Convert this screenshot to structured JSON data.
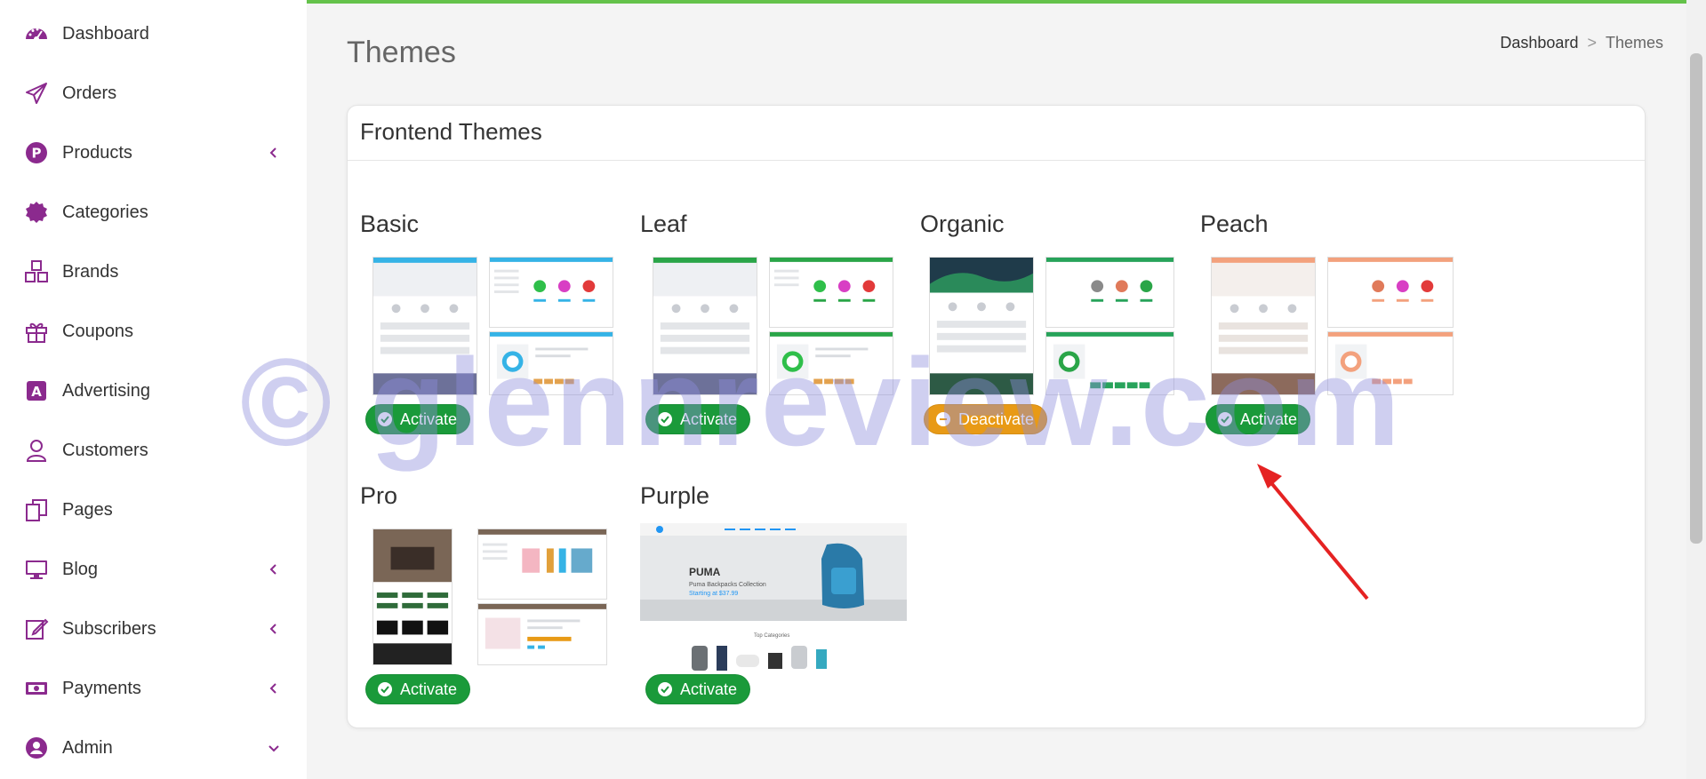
{
  "colors": {
    "accent": "#8b2a8e",
    "topbar": "#64c24a",
    "activate": "#1a9a3a",
    "deactivate": "#e89a16",
    "arrow": "#e52222"
  },
  "sidebar": {
    "items": [
      {
        "label": "Dashboard",
        "icon": "dashboard-gauge-icon",
        "chevron": ""
      },
      {
        "label": "Orders",
        "icon": "paper-plane-icon",
        "chevron": ""
      },
      {
        "label": "Products",
        "icon": "p-circle-icon",
        "chevron": "chevron-left-icon"
      },
      {
        "label": "Categories",
        "icon": "badge-icon",
        "chevron": ""
      },
      {
        "label": "Brands",
        "icon": "cubes-icon",
        "chevron": ""
      },
      {
        "label": "Coupons",
        "icon": "gift-icon",
        "chevron": ""
      },
      {
        "label": "Advertising",
        "icon": "ad-square-icon",
        "chevron": ""
      },
      {
        "label": "Customers",
        "icon": "user-icon",
        "chevron": ""
      },
      {
        "label": "Pages",
        "icon": "pages-icon",
        "chevron": ""
      },
      {
        "label": "Blog",
        "icon": "monitor-icon",
        "chevron": "chevron-left-icon"
      },
      {
        "label": "Subscribers",
        "icon": "edit-icon",
        "chevron": "chevron-left-icon"
      },
      {
        "label": "Payments",
        "icon": "money-bill-icon",
        "chevron": "chevron-left-icon"
      },
      {
        "label": "Admin",
        "icon": "user-circle-icon",
        "chevron": "chevron-down-icon"
      }
    ]
  },
  "header": {
    "title": "Themes",
    "breadcrumb": {
      "home": "Dashboard",
      "separator": ">",
      "current": "Themes"
    }
  },
  "card": {
    "title": "Frontend Themes"
  },
  "themes": [
    {
      "name": "Basic",
      "button": "Activate",
      "state": "inactive",
      "palette": "#35b3e6"
    },
    {
      "name": "Leaf",
      "button": "Activate",
      "state": "inactive",
      "palette": "#2aa548"
    },
    {
      "name": "Organic",
      "button": "Deactivate",
      "state": "active",
      "palette": "#27a35a"
    },
    {
      "name": "Peach",
      "button": "Activate",
      "state": "inactive",
      "palette": "#f3a17d"
    },
    {
      "name": "Pro",
      "button": "Activate",
      "state": "inactive",
      "palette": "#7a6656"
    },
    {
      "name": "Purple",
      "button": "Activate",
      "state": "inactive",
      "palette": "#2196f3"
    }
  ],
  "purple_preview": {
    "brand": "PUMA",
    "headline": "Puma Backpacks Collection",
    "subline": "Starting at $37.99",
    "section": "Top Categories"
  },
  "watermark": "© glennreview.com"
}
